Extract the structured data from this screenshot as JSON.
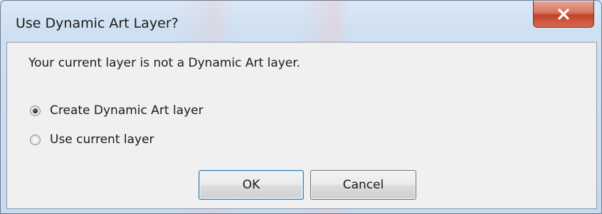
{
  "window": {
    "title": "Use Dynamic Art Layer?",
    "close_icon": "close-x-icon",
    "close_color": "#c7432b"
  },
  "dialog": {
    "message": "Your current layer is not a Dynamic Art layer.",
    "options": [
      {
        "label": "Create Dynamic Art layer",
        "selected": true
      },
      {
        "label": "Use current layer",
        "selected": false
      }
    ],
    "buttons": {
      "ok_label": "OK",
      "cancel_label": "Cancel"
    }
  }
}
